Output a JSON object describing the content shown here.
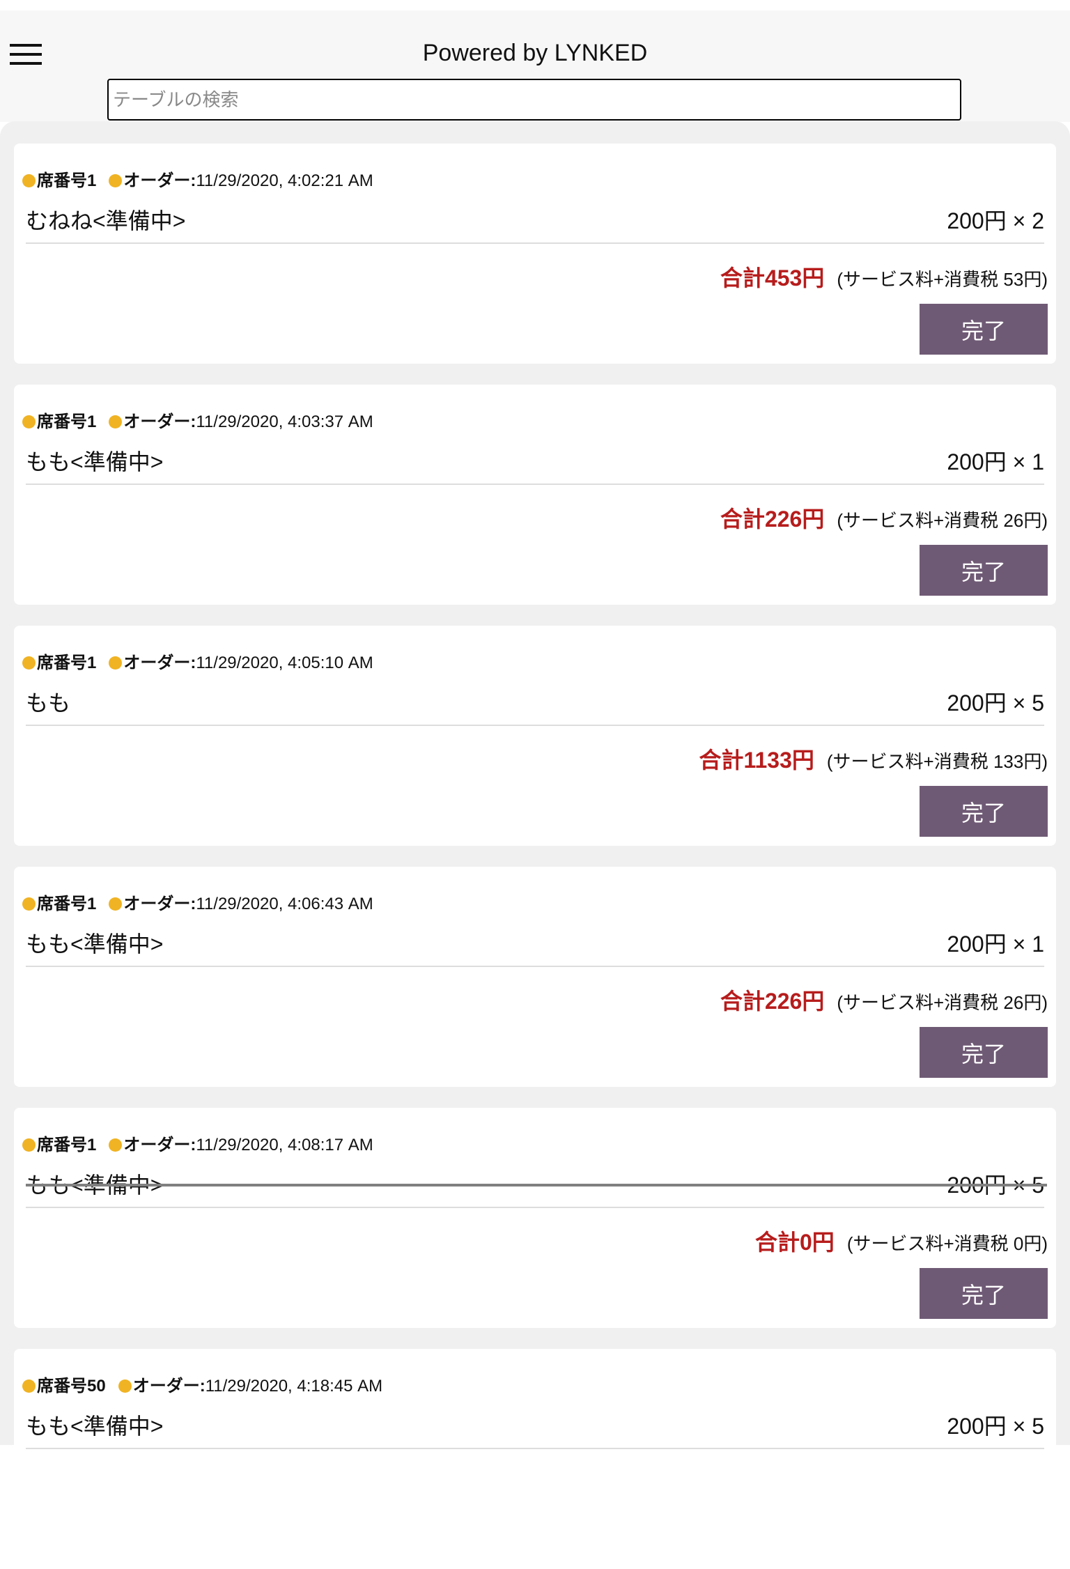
{
  "header": {
    "title": "Powered by LYNKED",
    "menu_icon": "hamburger-icon"
  },
  "search": {
    "placeholder": "テーブルの検索",
    "value": ""
  },
  "colors": {
    "accent_button": "#6f5a75",
    "total_text": "#b71c1c",
    "status_dot": "#f0b323"
  },
  "orders": [
    {
      "seat": "席番号1",
      "order_label": "オーダー:",
      "time": "11/29/2020, 4:02:21 AM",
      "item": "むねね<準備中>",
      "price": "200円 × 2",
      "total": "合計453円",
      "tax": "(サービス料+消費税 53円)",
      "done": "完了",
      "cancelled": false
    },
    {
      "seat": "席番号1",
      "order_label": "オーダー:",
      "time": "11/29/2020, 4:03:37 AM",
      "item": "もも<準備中>",
      "price": "200円 × 1",
      "total": "合計226円",
      "tax": "(サービス料+消費税 26円)",
      "done": "完了",
      "cancelled": false
    },
    {
      "seat": "席番号1",
      "order_label": "オーダー:",
      "time": "11/29/2020, 4:05:10 AM",
      "item": "もも",
      "price": "200円 × 5",
      "total": "合計1133円",
      "tax": "(サービス料+消費税 133円)",
      "done": "完了",
      "cancelled": false
    },
    {
      "seat": "席番号1",
      "order_label": "オーダー:",
      "time": "11/29/2020, 4:06:43 AM",
      "item": "もも<準備中>",
      "price": "200円 × 1",
      "total": "合計226円",
      "tax": "(サービス料+消費税 26円)",
      "done": "完了",
      "cancelled": false
    },
    {
      "seat": "席番号1",
      "order_label": "オーダー:",
      "time": "11/29/2020, 4:08:17 AM",
      "item": "もも<準備中>",
      "price": "200円 × 5",
      "total": "合計0円",
      "tax": "(サービス料+消費税 0円)",
      "done": "完了",
      "cancelled": true
    },
    {
      "seat": "席番号50",
      "order_label": "オーダー:",
      "time": "11/29/2020, 4:18:45 AM",
      "item": "もも<準備中>",
      "price": "200円 × 5",
      "total": "",
      "tax": "",
      "done": "",
      "cancelled": false
    }
  ]
}
